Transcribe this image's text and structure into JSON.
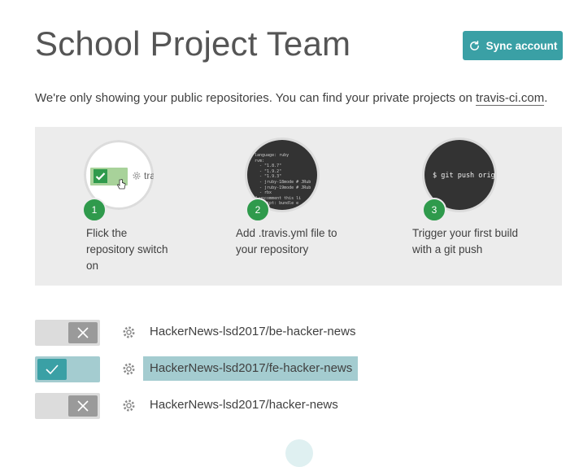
{
  "header": {
    "title": "School Project Team",
    "sync_label": "Sync account"
  },
  "notice": {
    "text": "We're only showing your public repositories. You can find your private projects on ",
    "link": "travis-ci.com",
    "suffix": "."
  },
  "getting_started": {
    "steps": [
      {
        "number": "1",
        "text": "Flick the repository switch on",
        "illustration_text": "tra"
      },
      {
        "number": "2",
        "text": "Add .travis.yml file to your repository",
        "code": [
          "language: ruby",
          "rvm:",
          "  - \"1.8.7\"",
          "  - \"1.9.2\"",
          "  - \"1.9.3\"",
          "  - jruby-18mode # JRub",
          "  - jruby-19mode # JRub",
          "  - rbx",
          "# uncomment this li",
          "# script: bundle e"
        ]
      },
      {
        "number": "3",
        "text": "Trigger your first build with a git push",
        "command": "$ git push origin"
      }
    ]
  },
  "repos": [
    {
      "name": "HackerNews-lsd2017/be-hacker-news",
      "enabled": false
    },
    {
      "name": "HackerNews-lsd2017/fe-hacker-news",
      "enabled": true
    },
    {
      "name": "HackerNews-lsd2017/hacker-news",
      "enabled": false
    }
  ],
  "colors": {
    "accent": "#3aa0a5",
    "step_badge": "#2f9a4c",
    "panel": "#ececec"
  }
}
